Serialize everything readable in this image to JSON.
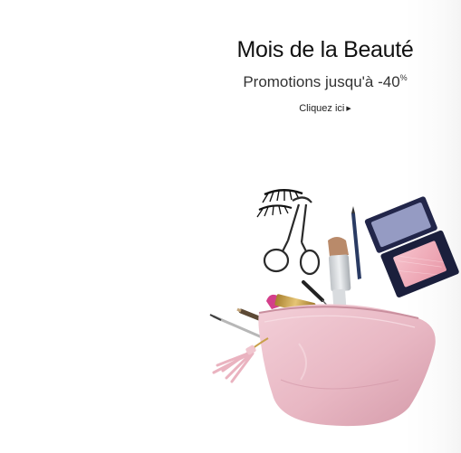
{
  "promo": {
    "title": "Mois de la Beauté",
    "subtitle_text": "Promotions jusqu'à -40",
    "subtitle_suffix": "%",
    "cta_label": "Cliquez ici",
    "cta_icon": "triangle-right-icon"
  },
  "colors": {
    "pouch": "#e8b7c3",
    "pouch_shadow": "#d99cab",
    "blush": "#f1a9b6",
    "compact": "#1b1f3c",
    "lipstick": "#d43f8a",
    "gold": "#c9a04a"
  }
}
